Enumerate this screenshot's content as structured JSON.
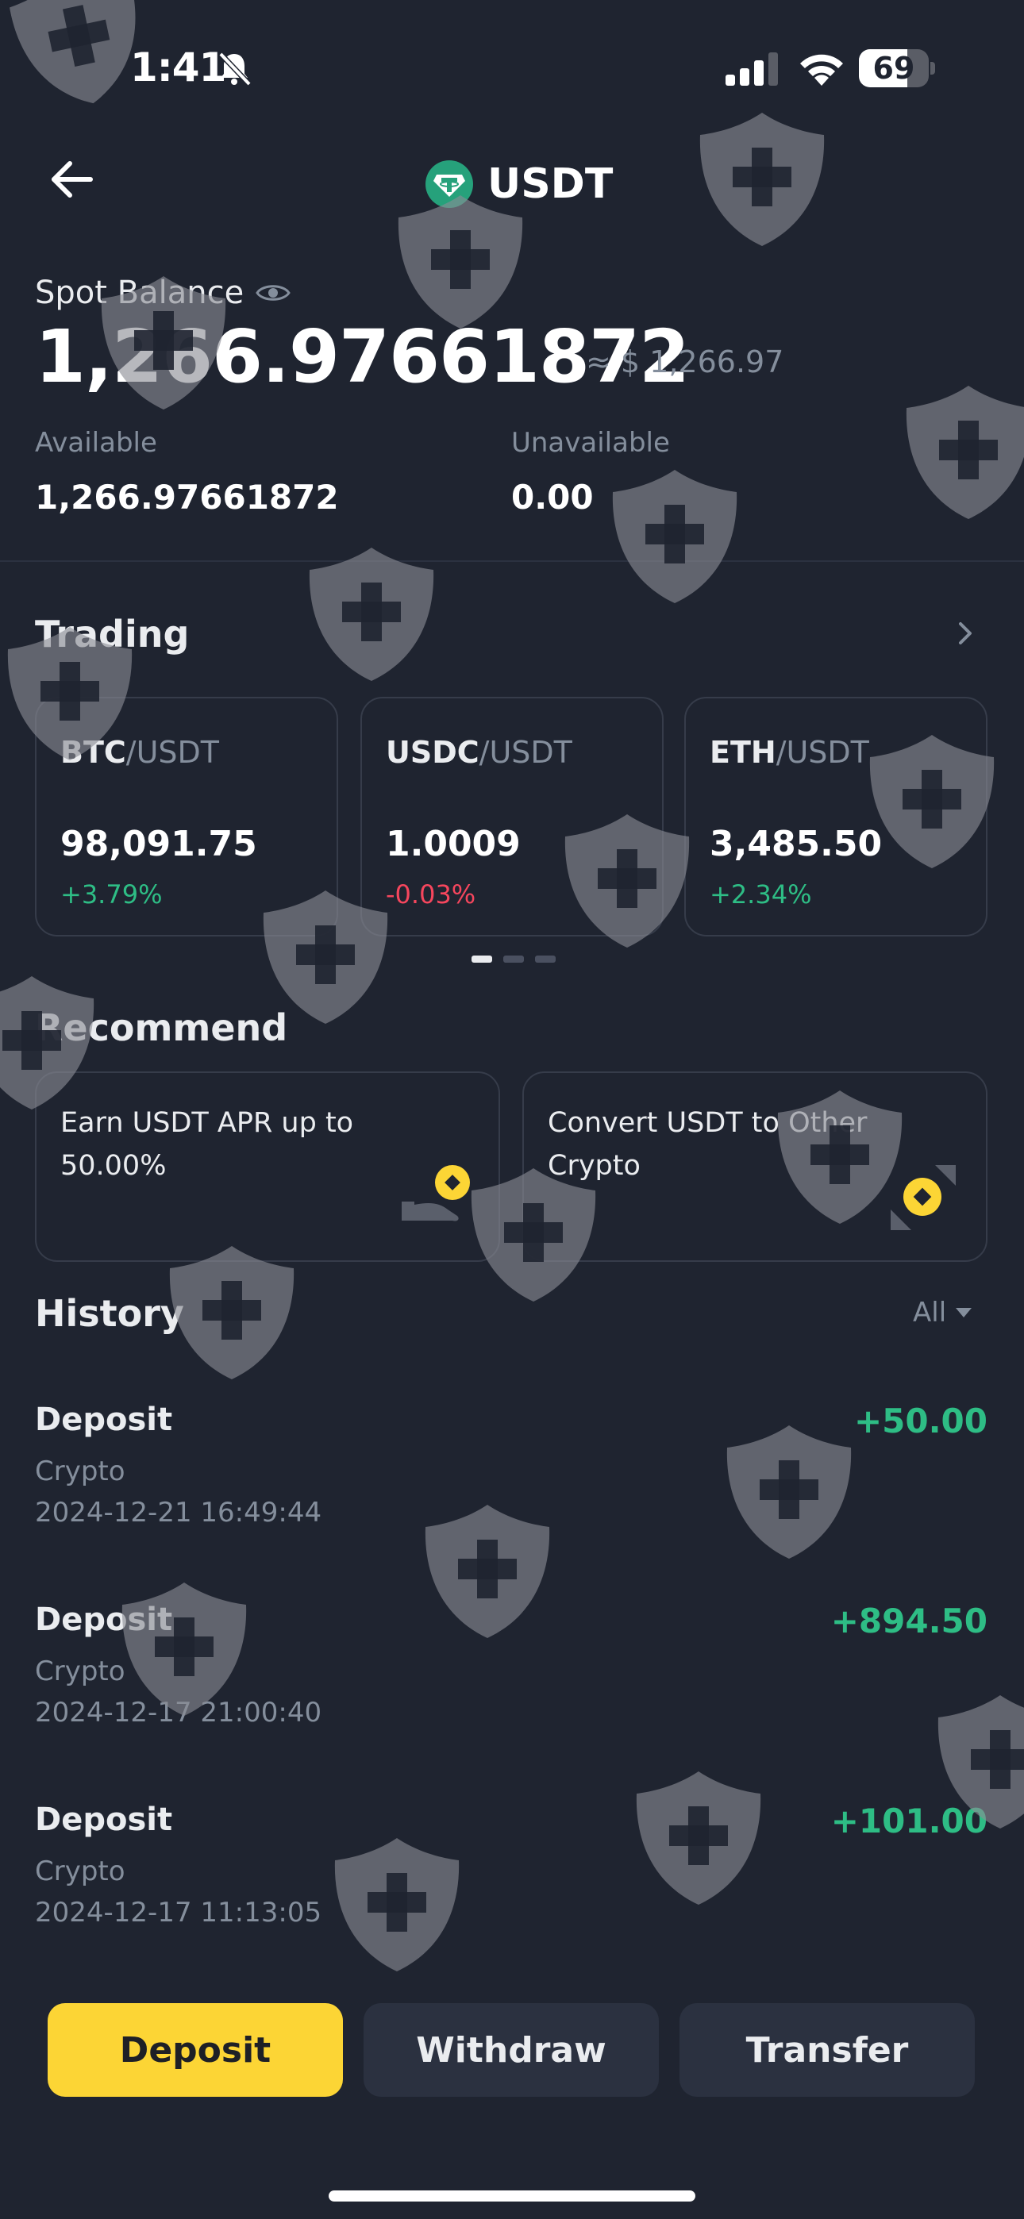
{
  "status_bar": {
    "time": "1:41",
    "battery_level": "69",
    "battery_fraction": 0.69
  },
  "header": {
    "title": "USDT",
    "back_icon": "arrow-left-icon",
    "coin_icon": "tether-icon"
  },
  "balance": {
    "label": "Spot Balance",
    "amount": "1,266.97661872",
    "approx_usd": "≈ $ 1,266.97",
    "available_label": "Available",
    "available_value": "1,266.97661872",
    "unavailable_label": "Unavailable",
    "unavailable_value": "0.00"
  },
  "trading": {
    "title": "Trading",
    "pairs": [
      {
        "base": "BTC",
        "quote": "/USDT",
        "price": "98,091.75",
        "change": "+3.79%",
        "direction": "up"
      },
      {
        "base": "USDC",
        "quote": "/USDT",
        "price": "1.0009",
        "change": "-0.03%",
        "direction": "down"
      },
      {
        "base": "ETH",
        "quote": "/USDT",
        "price": "3,485.50",
        "change": "+2.34%",
        "direction": "up"
      }
    ],
    "page_count": 3,
    "active_page": 1
  },
  "recommend": {
    "title": "Recommend",
    "cards": [
      {
        "text": "Earn USDT APR up to 50.00%",
        "icon": "earn-coin-icon"
      },
      {
        "text": "Convert USDT to Other Crypto",
        "icon": "convert-icon"
      }
    ]
  },
  "history": {
    "title": "History",
    "filter_label": "All",
    "items": [
      {
        "type": "Deposit",
        "sub": "Crypto",
        "date": "2024-12-21 16:49:44",
        "amount": "+50.00"
      },
      {
        "type": "Deposit",
        "sub": "Crypto",
        "date": "2024-12-17 21:00:40",
        "amount": "+894.50"
      },
      {
        "type": "Deposit",
        "sub": "Crypto",
        "date": "2024-12-17 11:13:05",
        "amount": "+101.00"
      }
    ]
  },
  "actions": {
    "deposit": "Deposit",
    "withdraw": "Withdraw",
    "transfer": "Transfer"
  },
  "colors": {
    "background": "#1f2430",
    "accent": "#fcd535",
    "positive": "#2ebd85",
    "negative": "#f6465d",
    "muted": "#848e9c",
    "tether": "#26a17b"
  }
}
